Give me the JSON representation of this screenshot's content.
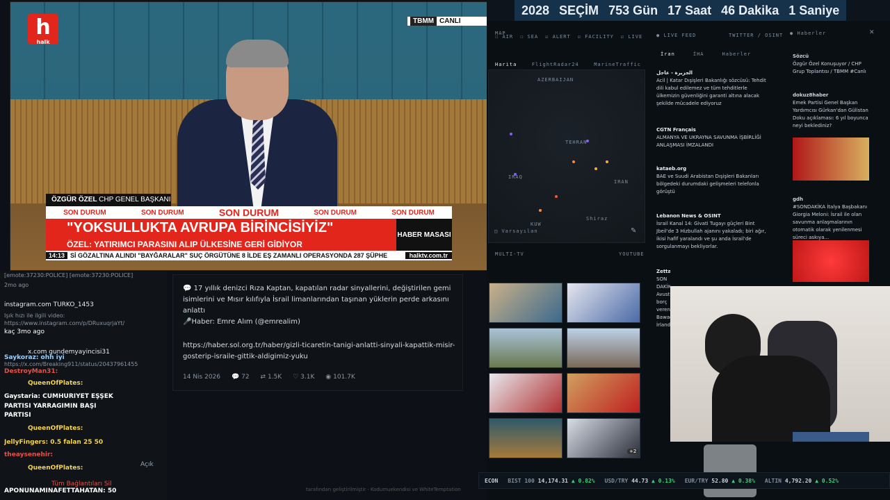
{
  "stream": {
    "channel_logo": "h",
    "channel_logo_sub": "halk",
    "live_source": "TBMM",
    "live_label": "CANLI",
    "speaker_name": "ÖZGÜR ÖZEL",
    "speaker_title": "CHP GENEL BAŞKANI",
    "son_durum": [
      "SON DURUM",
      "SON DURUM",
      "SON DURUM",
      "SON DURUM",
      "SON DURUM"
    ],
    "headline": "\"YOKSULLUKTA AVRUPA BİRİNCİSİYİZ\"",
    "subheadline": "ÖZEL: YATIRIMCI PARASINI ALIP ÜLKESİNE GERİ GİDİYOR",
    "side_label": "HABER MASASI",
    "ticker_time": "14:13",
    "ticker_text": "Sİ GÖZALTINA ALINDI   \"BAYĞARALAR\" SUÇ ÖRGÜTÜNE 8 İLDE EŞ ZAMANLI OPERASYONDA 287 ŞÜPHE",
    "ticker_site": "halktv.com.tr"
  },
  "chat": [
    {
      "text": "[emote:37230:POLICE] [emote:37230:POLICE]",
      "kind": "gray"
    },
    {
      "text": "2mo ago",
      "kind": "gray"
    },
    {
      "text": "instagram.com   TURKO_1453",
      "kind": "link"
    },
    {
      "text": "Işık hızı ile ilgili video:",
      "kind": "gray"
    },
    {
      "text": "https://www.instagram.com/p/DRuxuqrjaYt/",
      "kind": "gray"
    },
    {
      "text": "kaç  3mo ago",
      "kind": "white"
    },
    {
      "text": "x.com   gundemyayincisi31",
      "kind": "link"
    },
    {
      "text": "Saykoraz: ohh iyi",
      "kind": "user"
    },
    {
      "text": "https://x.com/Breaking911/status/20437961455",
      "kind": "gray"
    },
    {
      "text": "DestroyMan31:",
      "kind": "red"
    },
    {
      "text": "QueenOfPlates:",
      "kind": "user"
    },
    {
      "text": "Gaystaria: CUMHURİYET EŞŞEK",
      "kind": "user"
    },
    {
      "text": "PARTİSİ YARRAĞIMIN BAŞI",
      "kind": "white"
    },
    {
      "text": "PARTİSİ",
      "kind": "white"
    },
    {
      "text": "QueenOfPlates:",
      "kind": "user"
    },
    {
      "text": "JellyFingers: 0.5 falan   25   50",
      "kind": "user"
    },
    {
      "text": "theaysenehir:",
      "kind": "red"
    },
    {
      "text": "QueenOfPlates:",
      "kind": "user"
    },
    {
      "text": "Tüm Bağlantıları Sil",
      "kind": "red"
    },
    {
      "text": "APONUNAMINAFETTAHATAN: 50",
      "kind": "user"
    }
  ],
  "chat_open_label": "Açık",
  "tweet": {
    "body": "💬 17 yıllık denizci Rıza Kaptan, kapatılan radar sinyallerini, değiştirilen gemi isimlerini ve Mısır kılıfıyla İsrail limanlarından taşınan yüklerin perde arkasını anlattı",
    "reporter": "🎤Haber: Emre Alım (@emrealim)",
    "link": "https://haber.sol.org.tr/haber/gizli-ticaretin-tanigi-anlatti-sinyali-kapattik-misir-gosterip-israile-gittik-aldigimiz-yuku",
    "date": "14 Nis 2026",
    "replies": "72",
    "reposts": "1.5K",
    "likes": "3.1K",
    "views": "101.7K"
  },
  "footer_credit": "tarafından geliştirilmiştir · Kodumuekendisi ve WhiteTemptation",
  "dashboard": {
    "countdown": {
      "year": "2028",
      "label": "SEÇİM",
      "days": "753 Gün",
      "hours": "17 Saat",
      "minutes": "46 Dakika",
      "seconds": "1 Saniye"
    },
    "map_header": "MAP",
    "filters": [
      "AIR",
      "SEA",
      "ALERT",
      "FACILITY",
      "LIVE"
    ],
    "map_tabs": [
      "Harita",
      "FlightRadar24",
      "MarineTraffic"
    ],
    "map_labels": [
      "AZERBAIJAN",
      "TEHRAN",
      "IRAQ",
      "IRAN",
      "KUW",
      "Shiraz"
    ],
    "map_layer": "Varsayılan",
    "live_feed_header": "LIVE FEED",
    "live_feed_source": "TWITTER / OSINT",
    "feed_tabs": [
      "İran",
      "İHA",
      "Haberler"
    ],
    "feed": [
      {
        "source": "الجزيرة - عاجل",
        "text": "Acil | Katar Dışişleri Bakanlığı sözcüsü: Tehdit dili kabul edilemez ve tüm tehditlerle ülkemizin güvenliğini garanti altına alacak şekilde mücadele ediyoruz"
      },
      {
        "source": "CGTN Français",
        "text": "ALMANYA VE UKRAYNA SAVUNMA İŞBİRLİĞİ ANLAŞMASI İMZALANDI"
      },
      {
        "source": "kataeb.org",
        "text": "BAE ve Suudi Arabistan Dışişleri Bakanları bölgedeki durumdaki gelişmeleri telefonla görüştü"
      },
      {
        "source": "Lebanon News & OSINT",
        "text": "İsrail Kanal 14: Givati Tugayı güçleri Bint Jbeil'de 3 Hizbullah ajanını yakaladı; biri ağır, ikisi hafif yaralandı ve şu anda İsrail'de sorgulanmayı bekliyorlar."
      },
      {
        "source": "ZettaWire",
        "text": "SON DAKİKA: Avusturyalı borç veren Bawag, İrlanda..."
      }
    ],
    "news_header": "Haberler",
    "news": [
      {
        "source": "Sözcü",
        "text": "Özgür Özel Konuşuyor / CHP Grup Toplantısı / TBMM #Canlı"
      },
      {
        "source": "dokuz8haber",
        "text": "Emek Partisi Genel Başkan Yardımcısı Gürkan'dan Gülistan Doku açıklaması: 6 yıl boyunca neyi beklediniz?"
      },
      {
        "source": "gdh",
        "text": "#SONDAKİKA İtalya Başbakanı Giorgia Meloni: İsrail ile olan savunma anlaşmalarının otomatik olarak yenilenmesi süreci askıya..."
      }
    ],
    "multitv_header": "MULTI-TV",
    "multitv_source": "YOUTUBE",
    "multitv_more": "+2",
    "econ": {
      "label": "ECON",
      "items": [
        {
          "name": "BIST 100",
          "value": "14,174.31",
          "change": "▲ 0.82%"
        },
        {
          "name": "USD/TRY",
          "value": "44.73",
          "change": "▲ 0.13%"
        },
        {
          "name": "EUR/TRY",
          "value": "52.80",
          "change": "▲ 0.38%"
        },
        {
          "name": "ALTIN",
          "value": "4,792.20",
          "change": "▲ 0.52%"
        }
      ]
    }
  }
}
